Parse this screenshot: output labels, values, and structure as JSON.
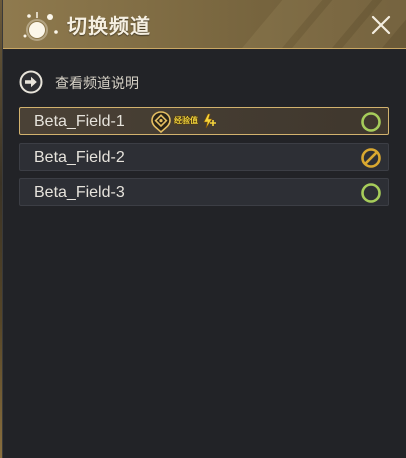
{
  "window": {
    "title": "切换频道",
    "close_icon": "close-icon",
    "logo_icon": "sparkle-orb-icon"
  },
  "info": {
    "label": "查看频道说明",
    "icon": "arrow-right-circle-icon"
  },
  "channels": [
    {
      "name": "Beta_Field-1",
      "selected": true,
      "status": "available",
      "status_icon": "open-circle-icon",
      "bonus": {
        "label": "经验值",
        "icon": "lightning-plus-icon",
        "pin_icon": "location-pin-icon"
      }
    },
    {
      "name": "Beta_Field-2",
      "selected": false,
      "status": "unavailable",
      "status_icon": "no-entry-icon"
    },
    {
      "name": "Beta_Field-3",
      "selected": false,
      "status": "available",
      "status_icon": "open-circle-icon"
    }
  ],
  "colors": {
    "header": "#8f7a4e",
    "panel": "#222327",
    "row": "#2d2f35",
    "selected_border": "#d2b26e",
    "status_available": "#a6cc5a",
    "status_unavailable": "#d9a830"
  }
}
